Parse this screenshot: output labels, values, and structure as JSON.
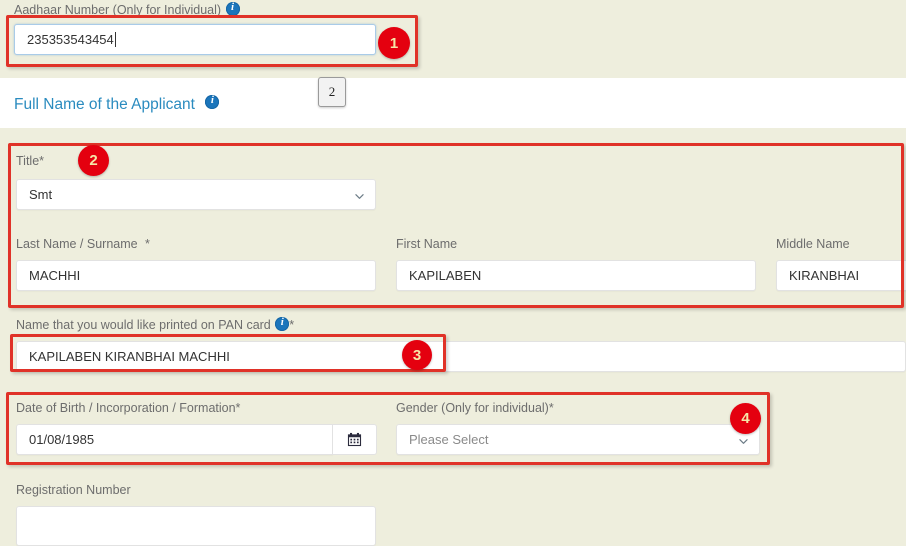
{
  "form": {
    "aadhaar": {
      "label": "Aadhaar Number (Only for Individual)",
      "info_icon": "info-icon",
      "value": "235353543454",
      "placeholder": ""
    },
    "section_header": {
      "title": "Full Name of the Applicant",
      "info_icon": "info-icon"
    },
    "title_field": {
      "label": "Title",
      "required": "*",
      "value": "Smt",
      "chevron_icon": "chevron-down-icon"
    },
    "last_name": {
      "label": "Last Name / Surname",
      "required": "*",
      "value": "MACHHI"
    },
    "first_name": {
      "label": "First Name",
      "value": "KAPILABEN"
    },
    "middle_name": {
      "label": "Middle Name",
      "value": "KIRANBHAI"
    },
    "pan_name": {
      "label": "Name that you would like printed on PAN card",
      "info_icon": "info-icon",
      "required": "*",
      "value": "KAPILABEN KIRANBHAI MACHHI"
    },
    "dob": {
      "label": "Date of Birth / Incorporation / Formation",
      "required": "*",
      "value": "01/08/1985",
      "calendar_icon": "calendar-icon"
    },
    "gender": {
      "label": "Gender (Only for individual)",
      "required": "*",
      "value": "Please Select",
      "chevron_icon": "chevron-down-icon"
    },
    "registration_number": {
      "label": "Registration Number",
      "value": ""
    }
  },
  "annotations": {
    "badges": [
      {
        "id": "1",
        "text": "1"
      },
      {
        "id": "2",
        "text": "2"
      },
      {
        "id": "3",
        "text": "3"
      },
      {
        "id": "4",
        "text": "4"
      }
    ],
    "step_box": {
      "text": "2"
    },
    "box_color": "#e03228",
    "badge_color": "#e4000f"
  }
}
